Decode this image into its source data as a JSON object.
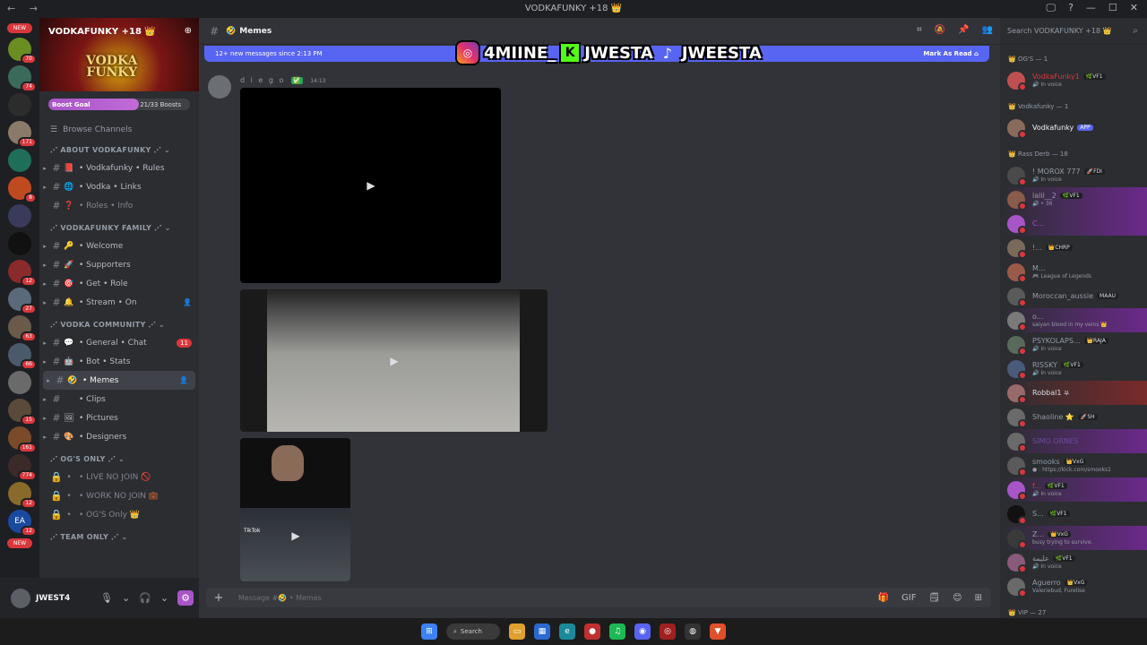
{
  "window": {
    "title": "VODKAFUNKY +18 👑",
    "nav": "← →",
    "controls": [
      "🖵",
      "?",
      "—",
      "☐",
      "✕"
    ]
  },
  "servers": [
    {
      "label": "NEW",
      "pill": true,
      "color": "#da373c"
    },
    {
      "label": "",
      "color": "#6b8e23",
      "badge": "70"
    },
    {
      "label": "",
      "color": "#3a6b5a",
      "badge": "74"
    },
    {
      "label": "",
      "color": "#2c2c2c"
    },
    {
      "label": "",
      "color": "#8a7a6a",
      "badge": "171"
    },
    {
      "label": "",
      "color": "#1f6e5a"
    },
    {
      "label": "",
      "color": "#c04a20",
      "badge": "8"
    },
    {
      "label": "",
      "color": "#3a3a5a"
    },
    {
      "label": "",
      "color": "#111111"
    },
    {
      "label": "",
      "color": "#8a2a2a",
      "badge": "12"
    },
    {
      "label": "",
      "color": "#5a6a7a",
      "badge": "27"
    },
    {
      "label": "",
      "color": "#6a5a4a",
      "badge": "63"
    },
    {
      "label": "",
      "color": "#4a5a6a",
      "badge": "66"
    },
    {
      "label": "",
      "color": "#6a6a6a"
    },
    {
      "label": "",
      "color": "#5a4a3a",
      "badge": "15"
    },
    {
      "label": "",
      "color": "#7a4a2a",
      "badge": "161"
    },
    {
      "label": "",
      "color": "#3a2a2a",
      "badge": "774"
    },
    {
      "label": "",
      "color": "#8a6a2a",
      "badge": "12"
    },
    {
      "label": "EA",
      "color": "#1a4aa0",
      "badge": "12"
    },
    {
      "label": "NEW",
      "pill": true,
      "color": "#da373c"
    }
  ],
  "server": {
    "name": "VODKAFUNKY +18 👑",
    "logo_line1": "VODKA",
    "logo_line2": "FUNKY",
    "boost_label": "Boost Goal",
    "boost_count": "21/33 Boosts",
    "boost_progress": 0.64,
    "browse": "Browse Channels"
  },
  "categories": [
    {
      "name": "⋰ ABOUT VODKAFUNKY ⋰ ⌄",
      "channels": [
        {
          "icon": "📕",
          "name": "• Vodkafunky • Rules"
        },
        {
          "icon": "🌐",
          "name": "• Vodka • Links"
        },
        {
          "icon": "❓",
          "name": "• Roles • Info",
          "dim": true,
          "noarrow": true
        }
      ]
    },
    {
      "name": "⋰ VODKAFUNKY FAMILY ⋰ ⌄",
      "channels": [
        {
          "icon": "🔑",
          "name": "• Welcome"
        },
        {
          "icon": "🚀",
          "name": "• Supporters"
        },
        {
          "icon": "🎯",
          "name": "• Get • Role"
        },
        {
          "icon": "🔔",
          "name": "• Stream • On",
          "rico": "👤"
        }
      ]
    },
    {
      "name": "⋰ VODKA COMMUNITY ⋰ ⌄",
      "channels": [
        {
          "icon": "💬",
          "name": "• General • Chat",
          "badge": "11"
        },
        {
          "icon": "🤖",
          "name": "• Bot • Stats"
        },
        {
          "icon": "🤣",
          "name": "• Memes",
          "active": true,
          "rico": "👤"
        },
        {
          "icon": "",
          "name": "• Clips"
        },
        {
          "icon": "🖼",
          "name": "• Pictures"
        },
        {
          "icon": "🎨",
          "name": "• Designers"
        }
      ]
    },
    {
      "name": "⋰ OG'S ONLY ⋰ ⌄",
      "channels": [
        {
          "icon": "🔒",
          "name": "• LIVE NO JOIN 🚫",
          "dim": true,
          "noarrow": true,
          "lock": true
        },
        {
          "icon": "🔒",
          "name": "• WORK NO JOIN 💼",
          "dim": true,
          "noarrow": true,
          "lock": true
        },
        {
          "icon": "🔒",
          "name": "• OG'S Only 👑",
          "dim": true,
          "noarrow": true,
          "lock": true
        }
      ]
    },
    {
      "name": "⋰ TEAM ONLY ⋰ ⌄",
      "channels": []
    }
  ],
  "user": {
    "name": "JWEST4",
    "controls": [
      "🎙",
      "⌄",
      "🎧",
      "⌄"
    ],
    "settings": "⚙"
  },
  "channel": {
    "name": "Memes",
    "emoji": "🤣"
  },
  "header_icons": [
    "⌗",
    "🔕",
    "📌",
    "👥"
  ],
  "new_messages": {
    "text": "12+ new messages since 2:13 PM",
    "action": "Mark As Read ⌂"
  },
  "overlay": {
    "instagram": "4MIINE_",
    "kick": "JWESTA",
    "tiktok": "JWEESTA"
  },
  "message": {
    "author": "d i e g o",
    "check": "✅",
    "time": "14:13",
    "tiktok_label": "TikTok"
  },
  "composer": {
    "placeholder": "Message #🤣 • Memes",
    "tools": [
      "🎁",
      "GIF",
      "🗒",
      "😊",
      "⊞"
    ]
  },
  "member_search": "Search VODKAFUNKY +18 👑",
  "member_groups": [
    {
      "title": "👑 OG'S — 1",
      "members": [
        {
          "name": "VodkaFunky1",
          "status": "🔊 In voice",
          "tag": "🌿VF1",
          "color": "#da373c",
          "av": "#c05050"
        }
      ]
    },
    {
      "title": "👑 Vodkafunky — 1",
      "members": [
        {
          "name": "Vodkafunky",
          "status": "",
          "app": "APP",
          "color": "#f2f3f5",
          "av": "#8a6a5a"
        }
      ]
    },
    {
      "title": "👑 Rass Derb — 18",
      "members": [
        {
          "name": "! MOROX 777",
          "status": "🔊 In voice",
          "tag": "🚀FDI",
          "color": "#949ba4",
          "av": "#4a4a4a"
        },
        {
          "name": "lalil__2",
          "status": "🔊 • 36",
          "tag": "🌿VF1",
          "color": "#949ba4",
          "av": "#8a5a4a",
          "hl": true
        },
        {
          "name": "C...",
          "status": "",
          "color": "#a855c7",
          "av": "#a855c7",
          "hl": true
        },
        {
          "name": "!...",
          "status": "",
          "tag": "👑CHRP",
          "color": "#949ba4",
          "av": "#7a6a5a"
        },
        {
          "name": "M...",
          "status": "🎮 League of Legends",
          "color": "#949ba4",
          "av": "#9a5a4a"
        },
        {
          "name": "Moroccan_aussie",
          "status": "",
          "tag": "MAAU",
          "color": "#949ba4",
          "av": "#5a5a5a"
        },
        {
          "name": "o...",
          "status": "saiyan blood in my veins 👑",
          "color": "#949ba4",
          "av": "#7a7a7a",
          "hl": true
        },
        {
          "name": "PSYKOLAPS...",
          "status": "🔊 In voice",
          "tag": "👑RAJA",
          "color": "#949ba4",
          "av": "#5a6a5a"
        },
        {
          "name": "RISSKY",
          "status": "🔊 In voice",
          "tag": "🌿VF1",
          "color": "#949ba4",
          "av": "#4a5a7a"
        },
        {
          "name": "Robbal1 ⛧",
          "status": "",
          "color": "#dbdee1",
          "av": "#9a6a6a",
          "hl2": true
        },
        {
          "name": "Shaoline ⭐",
          "status": "",
          "tag": "🚀SH",
          "color": "#949ba4",
          "av": "#6a6a6a"
        },
        {
          "name": "SIMO ORNES",
          "status": "",
          "color": "#6d4a9a",
          "av": "#6a6a6a",
          "hl": true
        },
        {
          "name": "smooks",
          "status": "● : https://kick.com/smooks1",
          "tag": "👑VxG",
          "color": "#949ba4",
          "av": "#5a5a5a"
        },
        {
          "name": "f...",
          "status": "🔊 In voice",
          "tag": "🌿VF1",
          "color": "#da373c",
          "av": "#a855c7",
          "hl": true
        },
        {
          "name": "S...",
          "status": "",
          "tag": "🌿VF1",
          "color": "#949ba4",
          "av": "#111111"
        },
        {
          "name": "Z...",
          "status": "busy trying to survive.",
          "tag": "👑VxG",
          "color": "#949ba4",
          "av": "#3a3a3a",
          "hl": true
        },
        {
          "name": "عليمة",
          "status": "🔊 In voice",
          "tag": "🌿VF1",
          "color": "#949ba4",
          "av": "#8a5a7a"
        },
        {
          "name": "Aguerro",
          "status": "Valeriebud, Furelise",
          "tag": "👑VxG",
          "color": "#949ba4",
          "av": "#6a6a6a"
        }
      ]
    },
    {
      "title": "👑 VIP — 27",
      "members": []
    }
  ],
  "taskbar": {
    "search": "Search"
  }
}
